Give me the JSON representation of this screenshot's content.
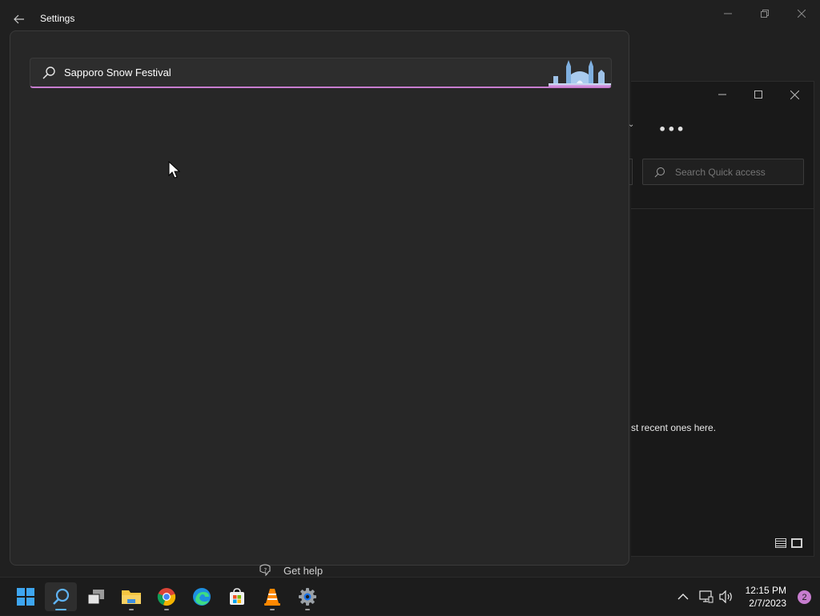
{
  "settings_window": {
    "title": "Settings",
    "back_icon": "back-arrow-icon"
  },
  "search": {
    "value": "Sapporo Snow Festival",
    "search_highlight": "Sapporo Snow Festival illustration",
    "accent_color": "#c77dcf"
  },
  "explorer": {
    "search_placeholder": "Search Quick access",
    "empty_message": "st recent ones here.",
    "more_label": "•••"
  },
  "get_help": {
    "label": "Get help"
  },
  "taskbar": {
    "apps": [
      {
        "name": "Start",
        "icon": "windows-start-icon"
      },
      {
        "name": "Search",
        "icon": "search-icon"
      },
      {
        "name": "Task View",
        "icon": "task-view-icon"
      },
      {
        "name": "File Explorer",
        "icon": "folder-icon"
      },
      {
        "name": "Google Chrome",
        "icon": "chrome-icon"
      },
      {
        "name": "Microsoft Edge",
        "icon": "edge-icon"
      },
      {
        "name": "Microsoft Store",
        "icon": "store-icon"
      },
      {
        "name": "VLC media player",
        "icon": "vlc-icon"
      },
      {
        "name": "Settings",
        "icon": "settings-gear-icon"
      }
    ],
    "time": "12:15 PM",
    "date": "2/7/2023",
    "notification_count": "2"
  }
}
